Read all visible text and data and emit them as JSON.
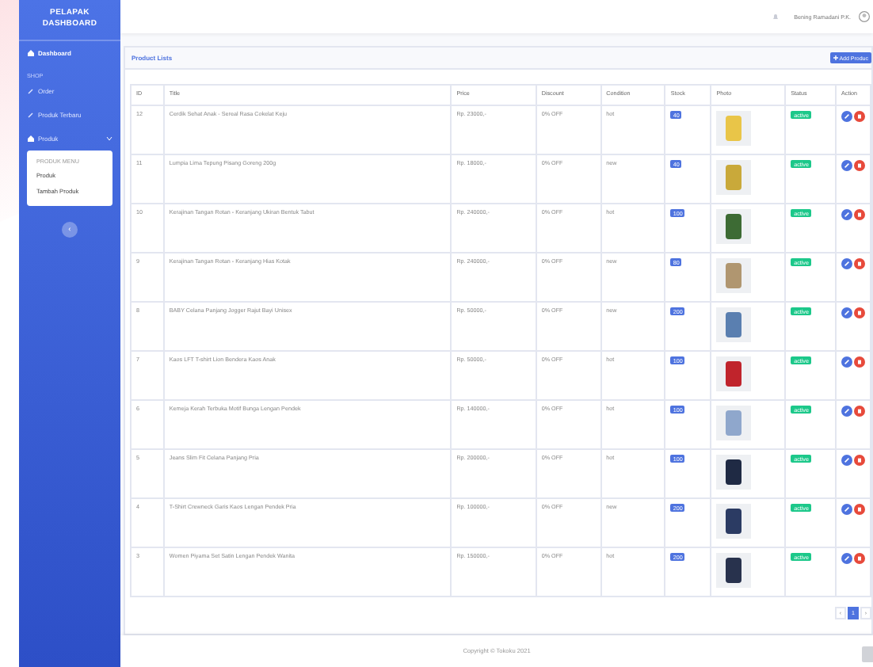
{
  "sidebar": {
    "brand": "PELAPAK DASHBOARD",
    "items": [
      {
        "kind": "link",
        "label": "Dashboard",
        "selected": true
      },
      {
        "kind": "heading",
        "label": "SHOP"
      },
      {
        "kind": "link",
        "label": "Order",
        "selected": false
      },
      {
        "kind": "link",
        "label": "Produk Terbaru",
        "selected": false
      },
      {
        "kind": "group",
        "label": "Produk",
        "expanded": true,
        "children": [
          {
            "kind": "caption",
            "label": "PRODUK MENU"
          },
          {
            "kind": "link",
            "label": "Produk",
            "selected": false
          },
          {
            "kind": "link",
            "label": "Tambah Produk",
            "selected": false
          }
        ]
      }
    ],
    "toggle": "‹"
  },
  "topbar": {
    "user": "Bening Ramadani P.K."
  },
  "card": {
    "title": "Product Lists",
    "add_button": "Add Produc"
  },
  "table": {
    "columns": [
      "ID",
      "Title",
      "Price",
      "Discount",
      "Condition",
      "Stock",
      "Photo",
      "Status",
      "Action"
    ],
    "rows": [
      {
        "id": "12",
        "title": "Cerdik Sehat Anak - Sereal Rasa Cokelat Keju",
        "price": "Rp. 23000,-",
        "discount": "0% OFF",
        "condition": "hot",
        "stock": "40",
        "status": "active"
      },
      {
        "id": "11",
        "title": "Lumpia Lima Tepung Pisang Goreng 200g",
        "price": "Rp. 18000,-",
        "discount": "0% OFF",
        "condition": "new",
        "stock": "40",
        "status": "active"
      },
      {
        "id": "10",
        "title": "Kerajinan Tangan Rotan - Keranjang Ukiran Bentuk Tabut",
        "price": "Rp. 240000,-",
        "discount": "0% OFF",
        "condition": "hot",
        "stock": "100",
        "status": "active"
      },
      {
        "id": "9",
        "title": "Kerajinan Tangan Rotan - Keranjang Hias Kotak",
        "price": "Rp. 240000,-",
        "discount": "0% OFF",
        "condition": "new",
        "stock": "80",
        "status": "active"
      },
      {
        "id": "8",
        "title": "BABY Celana Panjang Jogger Rajut Bayi Unisex",
        "price": "Rp. 50000,-",
        "discount": "0% OFF",
        "condition": "new",
        "stock": "200",
        "status": "active"
      },
      {
        "id": "7",
        "title": "Kaos LFT T-shirt Lion Bendera Kaos Anak",
        "price": "Rp. 50000,-",
        "discount": "0% OFF",
        "condition": "hot",
        "stock": "100",
        "status": "active"
      },
      {
        "id": "6",
        "title": "Kemeja Kerah Terbuka Motif Bunga Lengan Pendek",
        "price": "Rp. 140000,-",
        "discount": "0% OFF",
        "condition": "hot",
        "stock": "100",
        "status": "active"
      },
      {
        "id": "5",
        "title": "Jeans Slim Fit Celana Panjang Pria",
        "price": "Rp. 200000,-",
        "discount": "0% OFF",
        "condition": "hot",
        "stock": "100",
        "status": "active"
      },
      {
        "id": "4",
        "title": "T-Shirt Crewneck Garis Kaos Lengan Pendek Pria",
        "price": "Rp. 100000,-",
        "discount": "0% OFF",
        "condition": "new",
        "stock": "200",
        "status": "active"
      },
      {
        "id": "3",
        "title": "Women Piyama Set Satin Lengan Pendek Wanita",
        "price": "Rp. 150000,-",
        "discount": "0% OFF",
        "condition": "hot",
        "stock": "200",
        "status": "active"
      }
    ]
  },
  "pagination": [
    {
      "label": "‹",
      "selected": false
    },
    {
      "label": "1",
      "selected": true
    },
    {
      "label": "›",
      "selected": false
    }
  ],
  "footer": "Copyright © Tokoku 2021"
}
